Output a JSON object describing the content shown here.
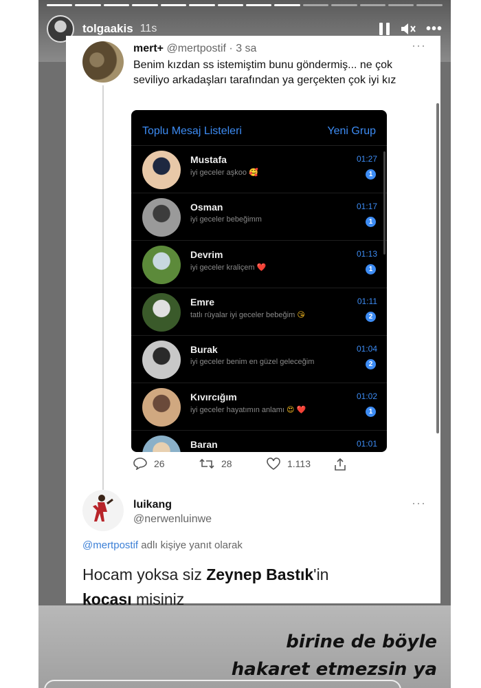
{
  "story": {
    "username": "tolgaakis",
    "time_ago": "11s",
    "progress_total": 14,
    "progress_done": 9
  },
  "tweet1": {
    "name": "mert+",
    "handle": "@mertpostif",
    "time": "· 3 sa",
    "text": "Benim kızdan ss istemiştim bunu göndermiş... ne çok seviliyo arkadaşları tarafından ya gerçekten çok iyi kız",
    "replies": "26",
    "retweets": "28",
    "likes": "1.113"
  },
  "phone": {
    "left_link": "Toplu Mesaj Listeleri",
    "right_link": "Yeni Grup",
    "chats": [
      {
        "name": "Mustafa",
        "message": "iyi geceler aşkoo",
        "emoji": "🥰",
        "time": "01:27",
        "badge": "1"
      },
      {
        "name": "Osman",
        "message": "iyi geceler bebeğimm",
        "emoji": "",
        "time": "01:17",
        "badge": "1"
      },
      {
        "name": "Devrim",
        "message": "iyi geceler kraliçem",
        "emoji": "❤️",
        "time": "01:13",
        "badge": "1"
      },
      {
        "name": "Emre",
        "message": "tatlı rüyalar iyi geceler bebeğim",
        "emoji": "😘",
        "time": "01:11",
        "badge": "2"
      },
      {
        "name": "Burak",
        "message": "iyi geceler benim en güzel geleceğim",
        "emoji": "",
        "time": "01:04",
        "badge": "2"
      },
      {
        "name": "Kıvırcığım",
        "message": "iyi geceler hayatımın anlamı",
        "emoji": "😍 ❤️",
        "time": "01:02",
        "badge": "1"
      },
      {
        "name": "Baran",
        "message": "",
        "emoji": "",
        "time": "01:01",
        "badge": ""
      }
    ]
  },
  "tweet2": {
    "name": "luikang",
    "handle": "@nerwenluinwe",
    "reply_mention": "@mertpostif",
    "reply_suffix": "adlı kişiye yanıt olarak",
    "text_part1": "Hocam yoksa siz ",
    "text_bold1": "Zeynep Bastık",
    "text_part2": "'in ",
    "text_bold2": "kocası",
    "text_part3": " misiniz"
  },
  "caption": {
    "line1": "birine de böyle",
    "line2": "hakaret etmezsin ya"
  }
}
